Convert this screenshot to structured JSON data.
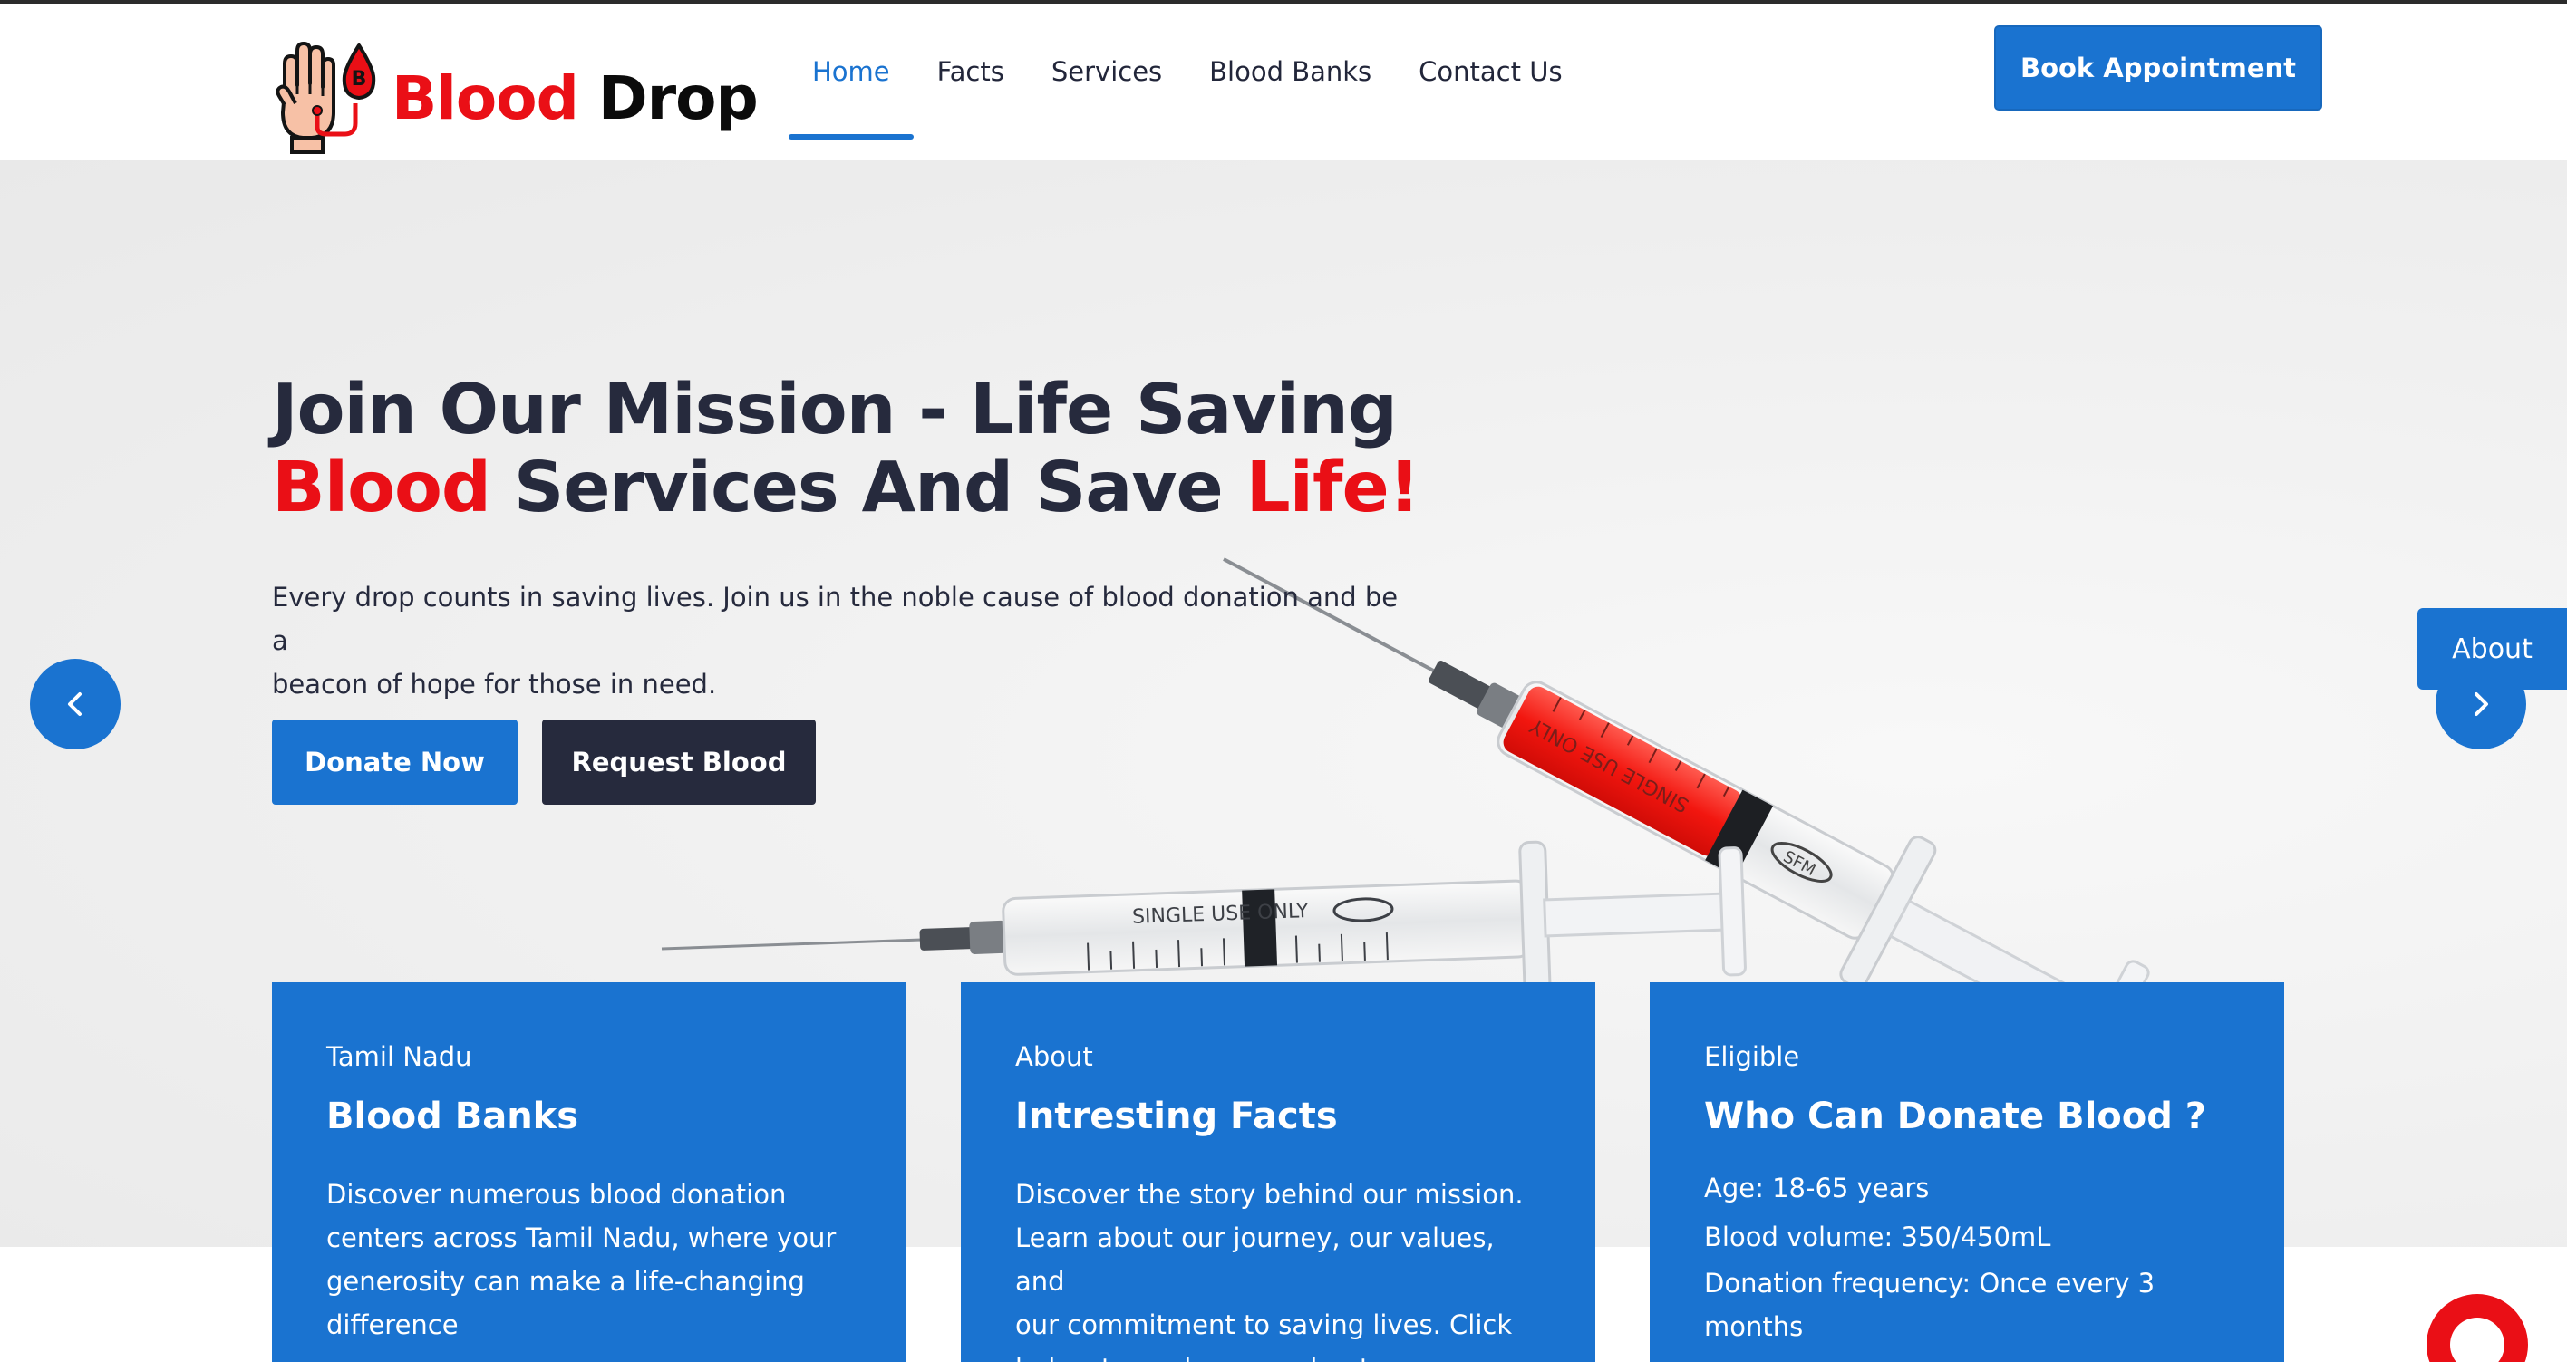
{
  "brand": {
    "word1": "Blood",
    "word2": "Drop",
    "logo_badge": "B"
  },
  "nav": [
    {
      "label": "Home",
      "active": true
    },
    {
      "label": "Facts",
      "active": false
    },
    {
      "label": "Services",
      "active": false
    },
    {
      "label": "Blood Banks",
      "active": false
    },
    {
      "label": "Contact Us",
      "active": false
    }
  ],
  "header": {
    "cta_label": "Book Appointment"
  },
  "hero": {
    "title_line1": "Join Our Mission - Life Saving",
    "title_line2_red1": "Blood",
    "title_line2_mid": "Services And Save",
    "title_line2_red2": "Life!",
    "subtitle_line1": "Every drop counts in saving lives. Join us in the noble cause of blood donation and be a",
    "subtitle_line2": "beacon of hope for those in need.",
    "donate_label": "Donate Now",
    "request_label": "Request Blood",
    "side_tab_label": "About"
  },
  "cards": [
    {
      "kicker": "Tamil Nadu",
      "title": "Blood Banks",
      "lines": [
        "Discover numerous blood donation",
        "centers across Tamil Nadu, where your",
        "generosity can make a life-changing",
        "difference"
      ]
    },
    {
      "kicker": "About",
      "title": "Intresting Facts",
      "lines": [
        "Discover the story behind our mission.",
        "Learn about our journey, our values, and",
        "our commitment to saving lives. Click",
        "below to explore our about page"
      ]
    },
    {
      "kicker": "Eligible",
      "title": "Who Can Donate Blood ?",
      "lines": [
        "Age: 18-65 years",
        "Blood volume: 350/450mL",
        "Donation frequency: Once every 3",
        "months"
      ]
    }
  ],
  "syringe_labels": {
    "big": "SINGLE USE ONLY",
    "small": "SINGLE USE ONLY",
    "brand": "SFM"
  },
  "colors": {
    "primary": "#1a73d0",
    "accent_red": "#ea0f16",
    "dark": "#262a3d"
  },
  "icons": {
    "prev": "chevron-left-icon",
    "next": "chevron-right-icon",
    "chat": "chat-icon"
  }
}
